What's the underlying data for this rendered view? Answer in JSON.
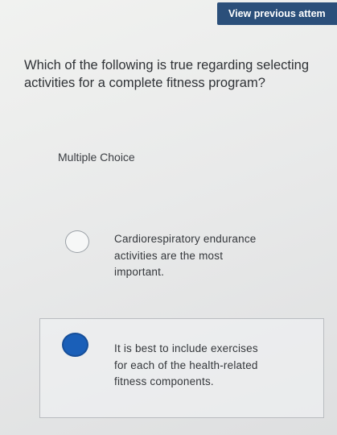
{
  "header": {
    "view_previous_label": "View previous attem"
  },
  "question": {
    "text": "Which of the following is true regarding selecting activities for a complete fitness program?",
    "type_label": "Multiple Choice"
  },
  "options": [
    {
      "text": "Cardiorespiratory endurance activities are the most important.",
      "selected": false
    },
    {
      "text": "It is best to include exercises for each of the health-related fitness components.",
      "selected": true
    }
  ],
  "colors": {
    "header_button": "#2b4f7a",
    "selected_radio": "#1a5fb8",
    "text": "#2f3236"
  }
}
